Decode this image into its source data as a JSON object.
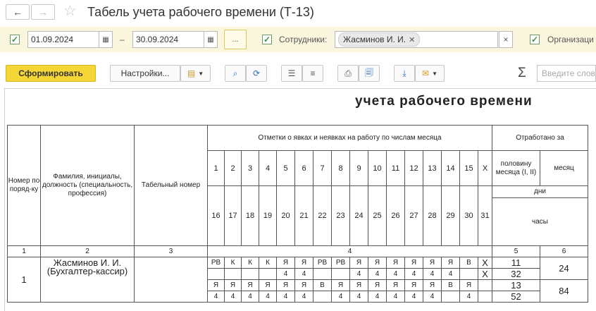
{
  "window": {
    "title": "Табель учета рабочего времени (Т-13)"
  },
  "nav": {
    "back_icon": "←",
    "forward_icon": "→",
    "star_icon": "☆"
  },
  "filters": {
    "date_from": "01.09.2024",
    "date_sep": "–",
    "date_to": "30.09.2024",
    "dots_label": "...",
    "employees_label": "Сотрудники:",
    "employee_tag": "Жасминов И. И.",
    "tag_remove_icon": "✕",
    "clear_icon": "×",
    "organization_label": "Организаци"
  },
  "toolbar": {
    "generate_label": "Сформировать",
    "settings_label": "Настройки...",
    "search_placeholder": "Введите слово"
  },
  "report": {
    "title": "учета  рабочего времени",
    "headers": {
      "num": "Номер по поряд-ку",
      "name": "Фамилия, инициалы, должность (специальность, профессия)",
      "tabnum": "Табельный номер",
      "marks": "Отметки о явках и неявках на работу по числам месяца",
      "worked": "Отработано за",
      "half": "половину месяца (I, II)",
      "month": "месяц",
      "days": "дни",
      "hours": "часы"
    },
    "days_first": [
      "1",
      "2",
      "3",
      "4",
      "5",
      "6",
      "7",
      "8",
      "9",
      "10",
      "11",
      "12",
      "13",
      "14",
      "15",
      "X"
    ],
    "days_second": [
      "16",
      "17",
      "18",
      "19",
      "20",
      "21",
      "22",
      "23",
      "24",
      "25",
      "26",
      "27",
      "28",
      "29",
      "30",
      "31"
    ],
    "col_numbers": [
      "1",
      "2",
      "3",
      "4",
      "5",
      "6"
    ],
    "row": {
      "num": "1",
      "name": "Жасминов И. И. (Бухгалтер-кассир)",
      "tabnum": "",
      "codes_first": [
        "РВ",
        "К",
        "К",
        "К",
        "Я",
        "Я",
        "РВ",
        "РВ",
        "Я",
        "Я",
        "Я",
        "Я",
        "Я",
        "Я",
        "В",
        "X"
      ],
      "hours_first": [
        "",
        "",
        "",
        "",
        "4",
        "4",
        "",
        "",
        "4",
        "4",
        "4",
        "4",
        "4",
        "4",
        "",
        "X"
      ],
      "codes_second": [
        "Я",
        "Я",
        "Я",
        "Я",
        "Я",
        "Я",
        "В",
        "Я",
        "Я",
        "Я",
        "Я",
        "Я",
        "Я",
        "В",
        "Я",
        ""
      ],
      "hours_second": [
        "4",
        "4",
        "4",
        "4",
        "4",
        "4",
        "",
        "4",
        "4",
        "4",
        "4",
        "4",
        "4",
        "",
        "4",
        ""
      ],
      "half1_days": "11",
      "half1_hours": "32",
      "half2_days": "13",
      "half2_hours": "52",
      "month1": "24",
      "month2": "84"
    }
  }
}
